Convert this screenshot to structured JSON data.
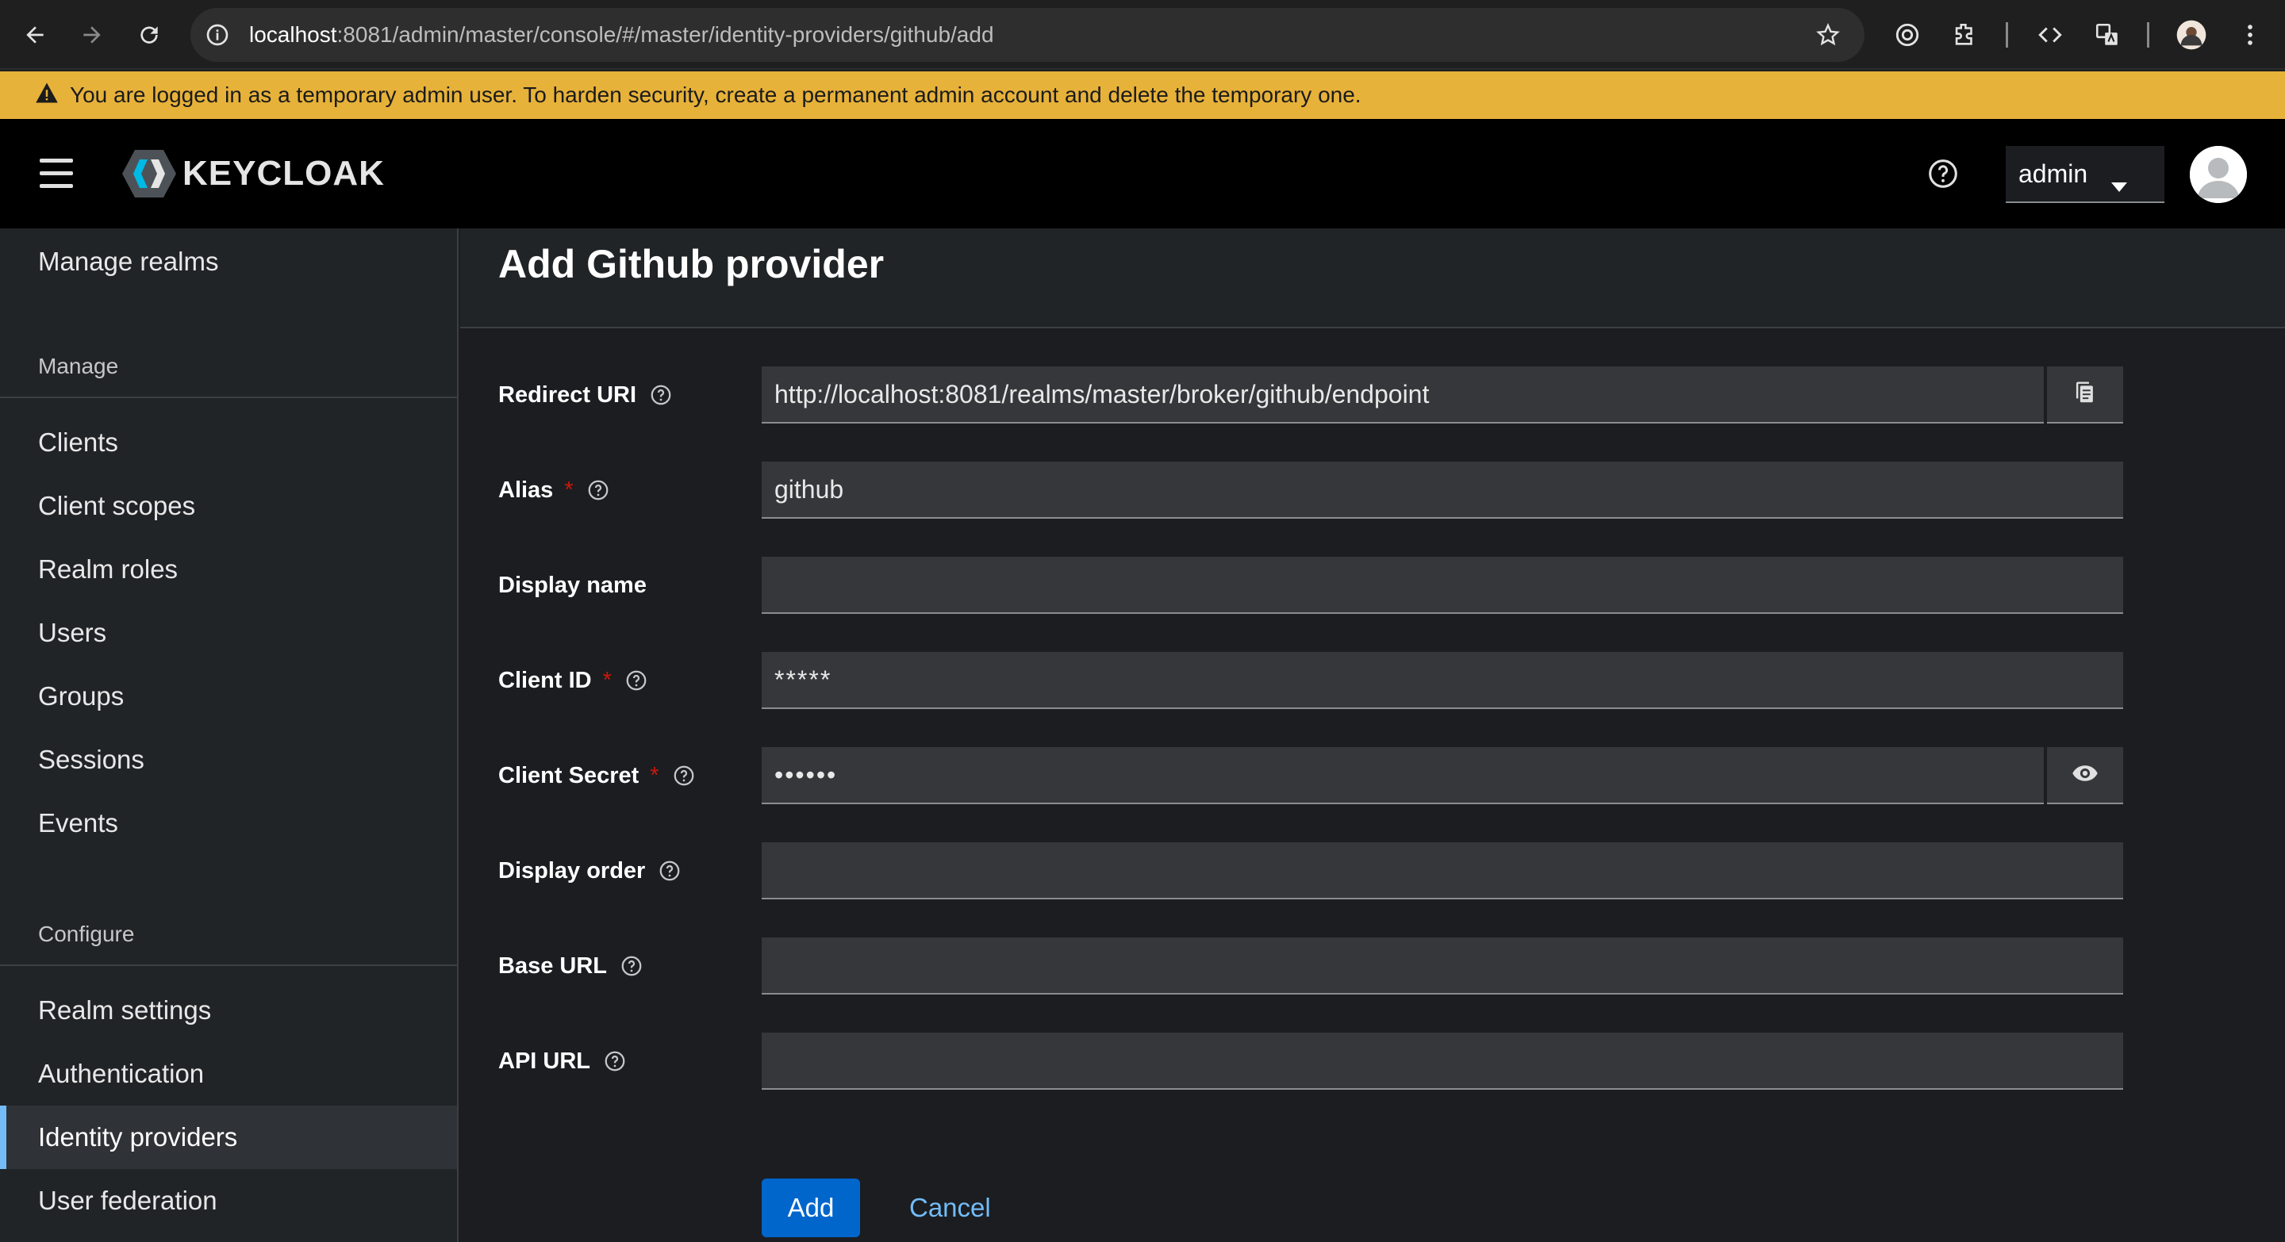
{
  "browser": {
    "url_host": "localhost",
    "url_rest": ":8081/admin/master/console/#/master/identity-providers/github/add"
  },
  "banner": {
    "text": "You are logged in as a temporary admin user. To harden security, create a permanent admin account and delete the temporary one."
  },
  "masthead": {
    "logo_text": "KEYCLOAK",
    "user": "admin"
  },
  "sidebar": {
    "top_item": "Manage realms",
    "manage_heading": "Manage",
    "manage_items": [
      "Clients",
      "Client scopes",
      "Realm roles",
      "Users",
      "Groups",
      "Sessions",
      "Events"
    ],
    "configure_heading": "Configure",
    "configure_items": [
      "Realm settings",
      "Authentication",
      "Identity providers",
      "User federation"
    ],
    "active_item": "Identity providers"
  },
  "page": {
    "title": "Add Github provider"
  },
  "form": {
    "redirect_uri": {
      "label": "Redirect URI",
      "value": "http://localhost:8081/realms/master/broker/github/endpoint"
    },
    "alias": {
      "label": "Alias",
      "required": "*",
      "value": "github"
    },
    "display_name": {
      "label": "Display name",
      "value": ""
    },
    "client_id": {
      "label": "Client ID",
      "required": "*",
      "value": "*****"
    },
    "client_secret": {
      "label": "Client Secret",
      "required": "*",
      "value": "••••••"
    },
    "display_order": {
      "label": "Display order",
      "value": ""
    },
    "base_url": {
      "label": "Base URL",
      "value": ""
    },
    "api_url": {
      "label": "API URL",
      "value": ""
    }
  },
  "actions": {
    "add": "Add",
    "cancel": "Cancel"
  },
  "colors": {
    "banner": "#e7b23a",
    "primary": "#0066cc",
    "link": "#73bcf7",
    "required": "#c9190b"
  }
}
